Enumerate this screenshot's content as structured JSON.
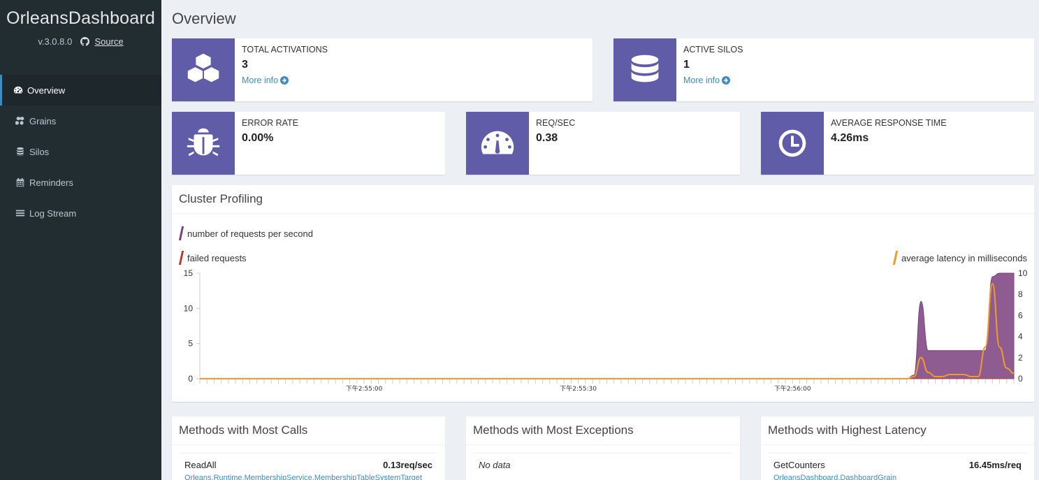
{
  "sidebar": {
    "brand": "OrleansDashboard",
    "version": "v.3.0.8.0",
    "source_label": "Source",
    "items": [
      {
        "label": "Overview",
        "icon": "dashboard-icon",
        "active": true
      },
      {
        "label": "Grains",
        "icon": "cubes-icon",
        "active": false
      },
      {
        "label": "Silos",
        "icon": "database-icon",
        "active": false
      },
      {
        "label": "Reminders",
        "icon": "calendar-icon",
        "active": false
      },
      {
        "label": "Log Stream",
        "icon": "list-icon",
        "active": false
      }
    ]
  },
  "page": {
    "title": "Overview"
  },
  "stats": {
    "total_activations": {
      "label": "TOTAL ACTIVATIONS",
      "value": "3",
      "more": "More info",
      "icon": "cubes-icon"
    },
    "active_silos": {
      "label": "ACTIVE SILOS",
      "value": "1",
      "more": "More info",
      "icon": "database-icon"
    },
    "error_rate": {
      "label": "ERROR RATE",
      "value": "0.00%",
      "icon": "bug-icon"
    },
    "req_sec": {
      "label": "REQ/SEC",
      "value": "0.38",
      "icon": "gauge-icon"
    },
    "avg_response": {
      "label": "AVERAGE RESPONSE TIME",
      "value": "4.26ms",
      "icon": "clock-icon"
    }
  },
  "cluster": {
    "title": "Cluster Profiling",
    "legend_requests": "number of requests per second",
    "legend_failed": "failed requests",
    "legend_latency": "average latency in milliseconds",
    "colors": {
      "requests": "#7b3f7f",
      "failed": "#c0392b",
      "latency": "#ee9a2c",
      "accent": "#605ca8"
    }
  },
  "chart_data": {
    "type": "area",
    "title": "Cluster Profiling",
    "x_tick_labels": [
      "下午2:55:00",
      "下午2:55:30",
      "下午2:56:00"
    ],
    "left_axis": {
      "ylim": [
        0,
        15
      ],
      "ticks": [
        0,
        5,
        10,
        15
      ]
    },
    "right_axis": {
      "ylim": [
        0,
        10
      ],
      "ticks": [
        0,
        2,
        4,
        6,
        8,
        10
      ]
    },
    "series": [
      {
        "name": "number of requests per second",
        "axis": "left",
        "type": "area",
        "values": [
          0,
          0,
          0,
          0,
          0,
          0,
          0,
          0,
          0,
          0,
          0,
          0,
          0,
          0,
          0,
          0,
          0,
          0,
          0,
          0,
          0,
          0,
          0,
          0,
          0,
          0,
          0,
          0,
          0,
          0,
          0,
          0,
          0,
          0,
          0,
          0,
          0,
          0,
          0,
          0,
          0,
          0,
          0,
          0,
          0,
          0,
          0,
          0,
          0,
          0,
          0,
          0,
          0,
          0,
          0,
          0,
          0,
          0,
          0,
          0,
          0,
          0,
          0,
          0,
          0,
          0,
          0,
          0,
          0,
          0,
          0,
          0,
          0,
          0,
          0,
          0,
          0,
          0,
          0,
          0,
          0,
          0,
          0,
          0,
          0,
          0,
          0,
          0,
          0,
          0,
          0,
          0,
          0,
          0,
          0,
          0,
          0,
          0,
          0,
          0,
          0.5,
          11,
          4,
          4,
          4,
          4,
          4,
          4,
          4,
          4,
          4,
          14.5,
          15,
          15,
          15
        ]
      },
      {
        "name": "failed requests",
        "axis": "left",
        "type": "line",
        "values": [
          0,
          0,
          0,
          0,
          0,
          0,
          0,
          0,
          0,
          0,
          0,
          0,
          0,
          0,
          0,
          0,
          0,
          0,
          0,
          0,
          0,
          0,
          0,
          0,
          0,
          0,
          0,
          0,
          0,
          0,
          0,
          0,
          0,
          0,
          0,
          0,
          0,
          0,
          0,
          0,
          0,
          0,
          0,
          0,
          0,
          0,
          0,
          0,
          0,
          0,
          0,
          0,
          0,
          0,
          0,
          0,
          0,
          0,
          0,
          0,
          0,
          0,
          0,
          0,
          0,
          0,
          0,
          0,
          0,
          0,
          0,
          0,
          0,
          0,
          0,
          0,
          0,
          0,
          0,
          0,
          0,
          0,
          0,
          0,
          0,
          0,
          0,
          0,
          0,
          0,
          0,
          0,
          0,
          0,
          0,
          0,
          0,
          0,
          0,
          0,
          0,
          0,
          0,
          0,
          0,
          0,
          0,
          0,
          0,
          0,
          0,
          0,
          0,
          0,
          0
        ]
      },
      {
        "name": "average latency in milliseconds",
        "axis": "right",
        "type": "line",
        "values": [
          0,
          0,
          0,
          0,
          0,
          0,
          0,
          0,
          0,
          0,
          0,
          0,
          0,
          0,
          0,
          0,
          0,
          0,
          0,
          0,
          0,
          0,
          0,
          0,
          0,
          0,
          0,
          0,
          0,
          0,
          0,
          0,
          0,
          0,
          0,
          0,
          0,
          0,
          0,
          0,
          0,
          0,
          0,
          0,
          0,
          0,
          0,
          0,
          0,
          0,
          0,
          0,
          0,
          0,
          0,
          0,
          0,
          0,
          0,
          0,
          0,
          0,
          0,
          0,
          0,
          0,
          0,
          0,
          0,
          0,
          0,
          0,
          0,
          0,
          0,
          0,
          0,
          0,
          0,
          0,
          0,
          0,
          0,
          0,
          0,
          0,
          0,
          0,
          0,
          0,
          0,
          0,
          0,
          0,
          0,
          0,
          0,
          0,
          0,
          0,
          0.2,
          2,
          0.6,
          0.2,
          0.2,
          0.4,
          0.4,
          0.4,
          0.2,
          0.2,
          3,
          9,
          3,
          1,
          0.5
        ]
      }
    ]
  },
  "methods_calls": {
    "title": "Methods with Most Calls",
    "rows": [
      {
        "name": "ReadAll",
        "value": "0.13req/sec",
        "sub": "Orleans.Runtime.MembershipService.MembershipTableSystemTarget"
      }
    ]
  },
  "methods_exceptions": {
    "title": "Methods with Most Exceptions",
    "empty": "No data"
  },
  "methods_latency": {
    "title": "Methods with Highest Latency",
    "rows": [
      {
        "name": "GetCounters",
        "value": "16.45ms/req",
        "sub": "OrleansDashboard.DashboardGrain"
      }
    ]
  }
}
